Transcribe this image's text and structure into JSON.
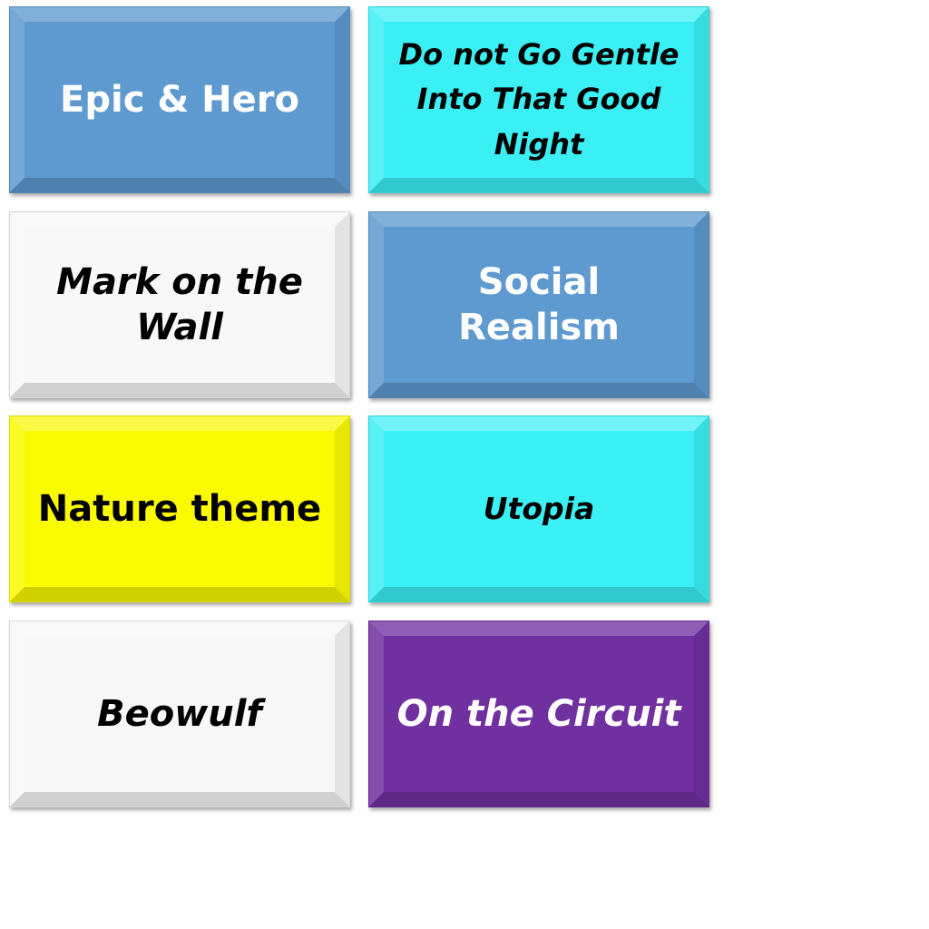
{
  "tiles": [
    {
      "label": "Epic & Hero",
      "color": "#5e9ad0"
    },
    {
      "label": "Do not Go Gentle Into That Good Night",
      "color": "#3af0f5"
    },
    {
      "label": "Mark on the Wall",
      "color": "#f8f8f8"
    },
    {
      "label": "Social Realism",
      "color": "#5e9ad0"
    },
    {
      "label": "Nature theme",
      "color": "#fafa00"
    },
    {
      "label": "Utopia",
      "color": "#3af0f5"
    },
    {
      "label": "Beowulf",
      "color": "#f8f8f8"
    },
    {
      "label": "On the Circuit",
      "color": "#7030a0"
    }
  ]
}
